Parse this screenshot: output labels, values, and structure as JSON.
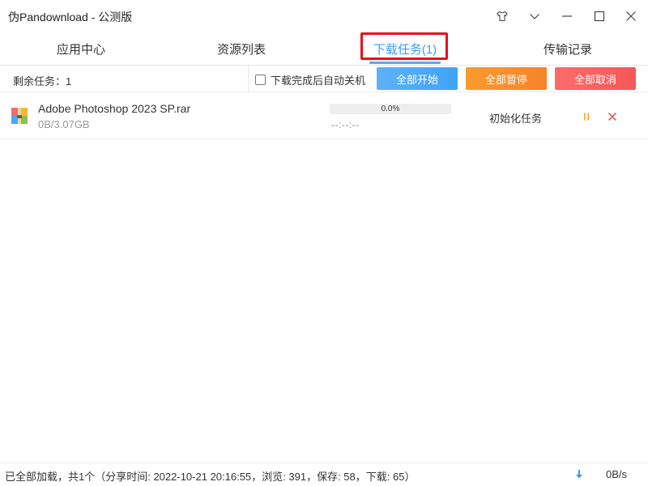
{
  "window": {
    "title": "伪Pandownload - 公测版",
    "controls": [
      "skin-icon",
      "chevron-down-icon",
      "minimize-icon",
      "maximize-icon",
      "close-icon"
    ]
  },
  "tabs": [
    {
      "label": "应用中心",
      "active": false
    },
    {
      "label": "资源列表",
      "active": false
    },
    {
      "label": "下载任务(1)",
      "active": true
    },
    {
      "label": "传输记录",
      "active": false
    }
  ],
  "toolbar": {
    "remaining": "剩余任务：1",
    "auto_shutdown_label": "下载完成后自动关机",
    "auto_shutdown_checked": false,
    "start_all": "全部开始",
    "pause_all": "全部暂停",
    "cancel_all": "全部取消"
  },
  "tasks": [
    {
      "name": "Adobe Photoshop 2023 SP.rar",
      "size": "0B/3.07GB",
      "progress_text": "0.0%",
      "progress": 0.0,
      "eta": "--:--:--",
      "status": "初始化任务",
      "icon": "rar-archive-icon"
    }
  ],
  "statusbar": {
    "text": "已全部加载，共1个（分享时间: 2022-10-21 20:16:55，浏览: 391，保存: 58，下载: 65）",
    "speed": "0B/s"
  },
  "colors": {
    "accent": "#3e9bf0",
    "start_button": "#4aa8f6",
    "pause_button": "#f88f2c",
    "cancel_button": "#f85f5f",
    "highlight": "#e8101a",
    "pause_icon": "#f5a623",
    "close_icon": "#f05a5a"
  }
}
